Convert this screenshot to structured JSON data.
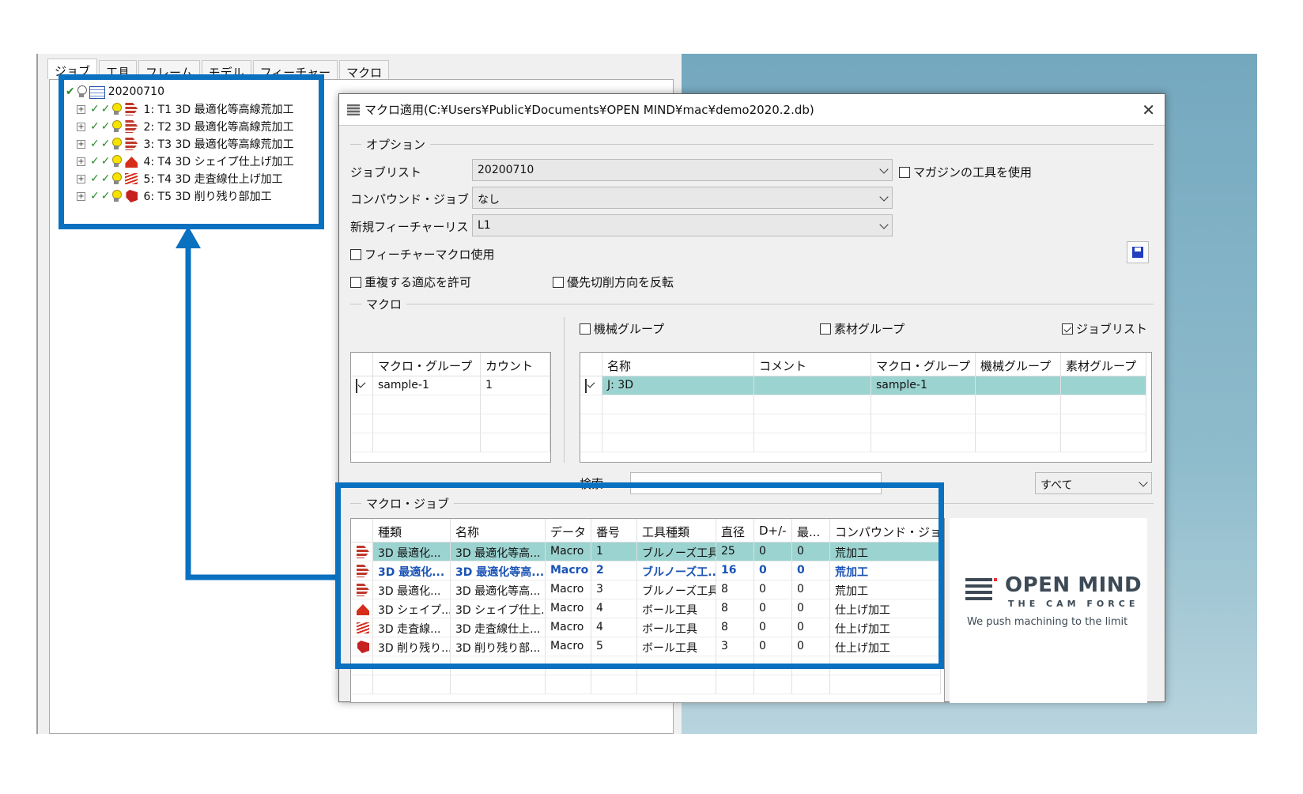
{
  "colors": {
    "highlight": "#0a70c0",
    "selected_row": "#9bd3d0",
    "bold_row_text": "#1a52b6"
  },
  "left_tabs": [
    "ジョブ",
    "工具",
    "フレーム",
    "モデル",
    "フィーチャー",
    "マクロ"
  ],
  "tree": {
    "root": "20200710",
    "items": [
      "1: T1 3D 最適化等高線荒加工",
      "2: T2 3D 最適化等高線荒加工",
      "3: T3 3D 最適化等高線荒加工",
      "4: T4 3D シェイプ仕上げ加工",
      "5: T4 3D 走査線仕上げ加工",
      "6: T5 3D 削り残り部加工"
    ]
  },
  "dialog": {
    "title": "マクロ適用(C:¥Users¥Public¥Documents¥OPEN MIND¥mac¥demo2020.2.db)",
    "options_group": "オプション",
    "joblist_label": "ジョブリスト",
    "joblist_value": "20200710",
    "compound_label": "コンパウンド・ジョブ",
    "compound_value": "なし",
    "feature_list_label": "新規フィーチャーリスト",
    "feature_list_value": "L1",
    "use_magazine": "マガジンの工具を使用",
    "feature_macro": "フィーチャーマクロ使用",
    "allow_dup": "重複する適応を許可",
    "reverse_dir": "優先切削方向を反転",
    "macro_group": "マクロ",
    "machine_group_cb": "機械グループ",
    "material_group_cb": "素材グループ",
    "joblist_cb": "ジョブリスト",
    "left_grid": {
      "headers": [
        "マクロ・グループ",
        "カウント"
      ],
      "rows": [
        [
          "sample-1",
          "1"
        ]
      ]
    },
    "right_grid": {
      "headers": [
        "名称",
        "コメント",
        "マクロ・グループ",
        "機械グループ",
        "素材グループ"
      ],
      "rows": [
        [
          "J: 3D",
          "",
          "sample-1",
          "",
          ""
        ]
      ]
    },
    "search_label": "検索",
    "filter_value": "すべて",
    "macro_job_group": "マクロ・ジョブ",
    "job_grid": {
      "headers": [
        "種類",
        "名称",
        "データ",
        "番号",
        "工具種類",
        "直径",
        "D+/-",
        "最...",
        "コンパウンド・ジョブ"
      ],
      "rows": [
        [
          "3D 最適化...",
          "3D 最適化等高...",
          "Macro",
          "1",
          "ブルノーズ工具",
          "25",
          "0",
          "0",
          "荒加工"
        ],
        [
          "3D 最適化...",
          "3D 最適化等高...",
          "Macro",
          "2",
          "ブルノーズ工...",
          "16",
          "0",
          "0",
          "荒加工"
        ],
        [
          "3D 最適化...",
          "3D 最適化等高...",
          "Macro",
          "3",
          "ブルノーズ工具",
          "8",
          "0",
          "0",
          "荒加工"
        ],
        [
          "3D シェイプ...",
          "3D シェイプ仕上...",
          "Macro",
          "4",
          "ボール工具",
          "8",
          "0",
          "0",
          "仕上げ加工"
        ],
        [
          "3D 走査線...",
          "3D 走査線仕上...",
          "Macro",
          "4",
          "ボール工具",
          "8",
          "0",
          "0",
          "仕上げ加工"
        ],
        [
          "3D 削り残り...",
          "3D 削り残り部...",
          "Macro",
          "5",
          "ボール工具",
          "3",
          "0",
          "0",
          "仕上げ加工"
        ]
      ]
    }
  },
  "logo": {
    "name": "OPEN MIND",
    "tagline": "THE CAM FORCE",
    "slogan": "We push machining to the limit"
  }
}
